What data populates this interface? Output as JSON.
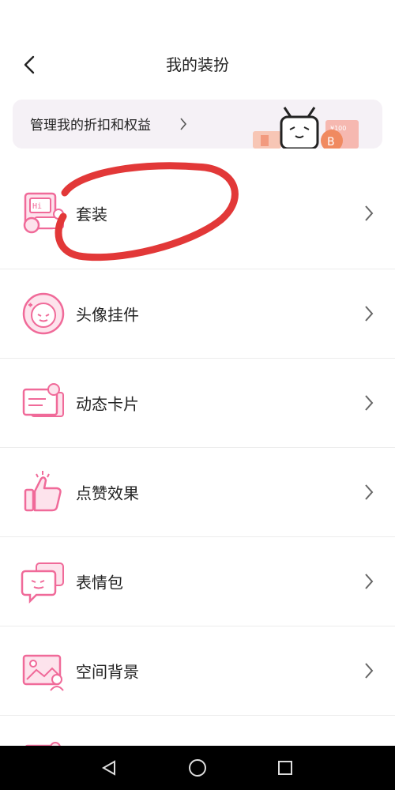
{
  "header": {
    "title": "我的装扮"
  },
  "banner": {
    "text": "管理我的折扣和权益",
    "price_tag": "¥100",
    "coin_letter": "B"
  },
  "items": [
    {
      "label": "套装",
      "icon": "suit-icon"
    },
    {
      "label": "头像挂件",
      "icon": "avatar-pendant-icon"
    },
    {
      "label": "动态卡片",
      "icon": "dynamic-card-icon"
    },
    {
      "label": "点赞效果",
      "icon": "like-effect-icon"
    },
    {
      "label": "表情包",
      "icon": "emoji-pack-icon"
    },
    {
      "label": "空间背景",
      "icon": "space-background-icon"
    }
  ],
  "navbar": {
    "buttons": [
      "back-triangle-icon",
      "home-circle-icon",
      "recents-square-icon"
    ]
  },
  "colors": {
    "accent_pink": "#f06a99",
    "annotation_red": "#e23838",
    "banner_bg": "#f5f1f6"
  }
}
